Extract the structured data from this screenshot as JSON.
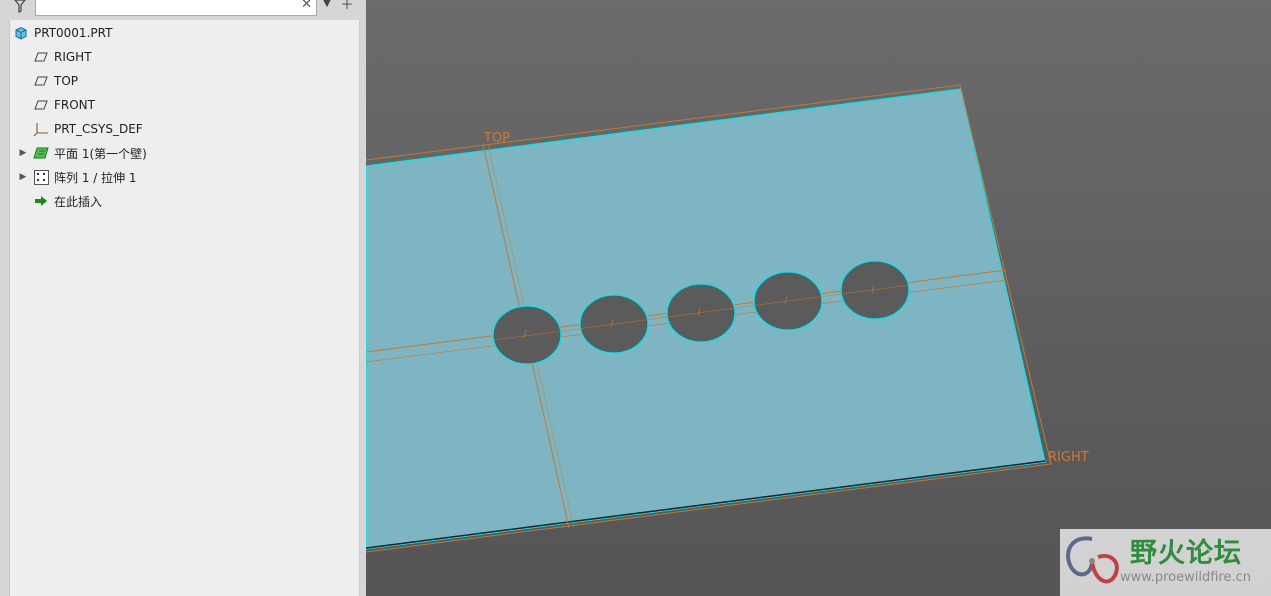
{
  "tree": {
    "search_value": "",
    "items": [
      {
        "label": "PRT0001.PRT",
        "icon": "part-icon",
        "expandable": false,
        "level": 0
      },
      {
        "label": "RIGHT",
        "icon": "datum-plane-icon",
        "expandable": false,
        "level": 1
      },
      {
        "label": "TOP",
        "icon": "datum-plane-icon",
        "expandable": false,
        "level": 1
      },
      {
        "label": "FRONT",
        "icon": "datum-plane-icon",
        "expandable": false,
        "level": 1
      },
      {
        "label": "PRT_CSYS_DEF",
        "icon": "csys-icon",
        "expandable": false,
        "level": 1
      },
      {
        "label": "平面 1(第一个壁)",
        "icon": "sheetmetal-wall-icon",
        "expandable": true,
        "level": 1
      },
      {
        "label": "阵列 1 / 拉伸 1",
        "icon": "pattern-icon",
        "expandable": true,
        "level": 1
      },
      {
        "label": "在此插入",
        "icon": "insert-here-icon",
        "expandable": false,
        "level": 1
      }
    ]
  },
  "viewport": {
    "datum_labels": {
      "top": "TOP",
      "right": "RIGHT"
    },
    "colors": {
      "plate_fill": "#7db6c2",
      "plate_edge": "#00e5f0",
      "datum": "#c8772e",
      "hole": "#5b5b5b"
    },
    "hole_count": 5
  },
  "watermark": {
    "title": "野火论坛",
    "url": "www.proewildfire.cn"
  }
}
